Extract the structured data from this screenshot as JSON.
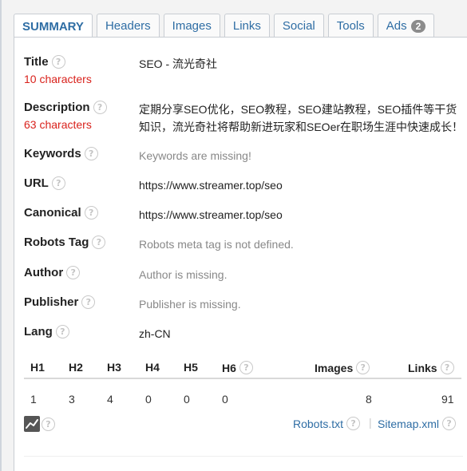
{
  "tabs": [
    {
      "label": "SUMMARY"
    },
    {
      "label": "Headers"
    },
    {
      "label": "Images"
    },
    {
      "label": "Links"
    },
    {
      "label": "Social"
    },
    {
      "label": "Tools"
    },
    {
      "label": "Ads",
      "badge": "2"
    }
  ],
  "summary": {
    "title": {
      "label": "Title",
      "count": "10 characters",
      "value": "SEO - 流光奇社"
    },
    "description": {
      "label": "Description",
      "count": "63 characters",
      "value": "定期分享SEO优化，SEO教程，SEO建站教程，SEO插件等干货知识，流光奇社将帮助新进玩家和SEOer在职场生涯中快速成长！"
    },
    "keywords": {
      "label": "Keywords",
      "value": "Keywords are missing!"
    },
    "url": {
      "label": "URL",
      "value": "https://www.streamer.top/seo"
    },
    "canonical": {
      "label": "Canonical",
      "value": "https://www.streamer.top/seo"
    },
    "robots": {
      "label": "Robots Tag",
      "value": "Robots meta tag is not defined."
    },
    "author": {
      "label": "Author",
      "value": "Author is missing."
    },
    "publisher": {
      "label": "Publisher",
      "value": "Publisher is missing."
    },
    "lang": {
      "label": "Lang",
      "value": "zh-CN"
    }
  },
  "headings_table": {
    "headers": [
      "H1",
      "H2",
      "H3",
      "H4",
      "H5",
      "H6",
      "Images",
      "Links"
    ],
    "values": [
      "1",
      "3",
      "4",
      "0",
      "0",
      "0",
      "8",
      "91"
    ]
  },
  "footer": {
    "robots_link": "Robots.txt",
    "sitemap_link": "Sitemap.xml",
    "separator": "|"
  },
  "help_glyph": "?",
  "icons": [
    "help-icon",
    "chart-icon"
  ]
}
